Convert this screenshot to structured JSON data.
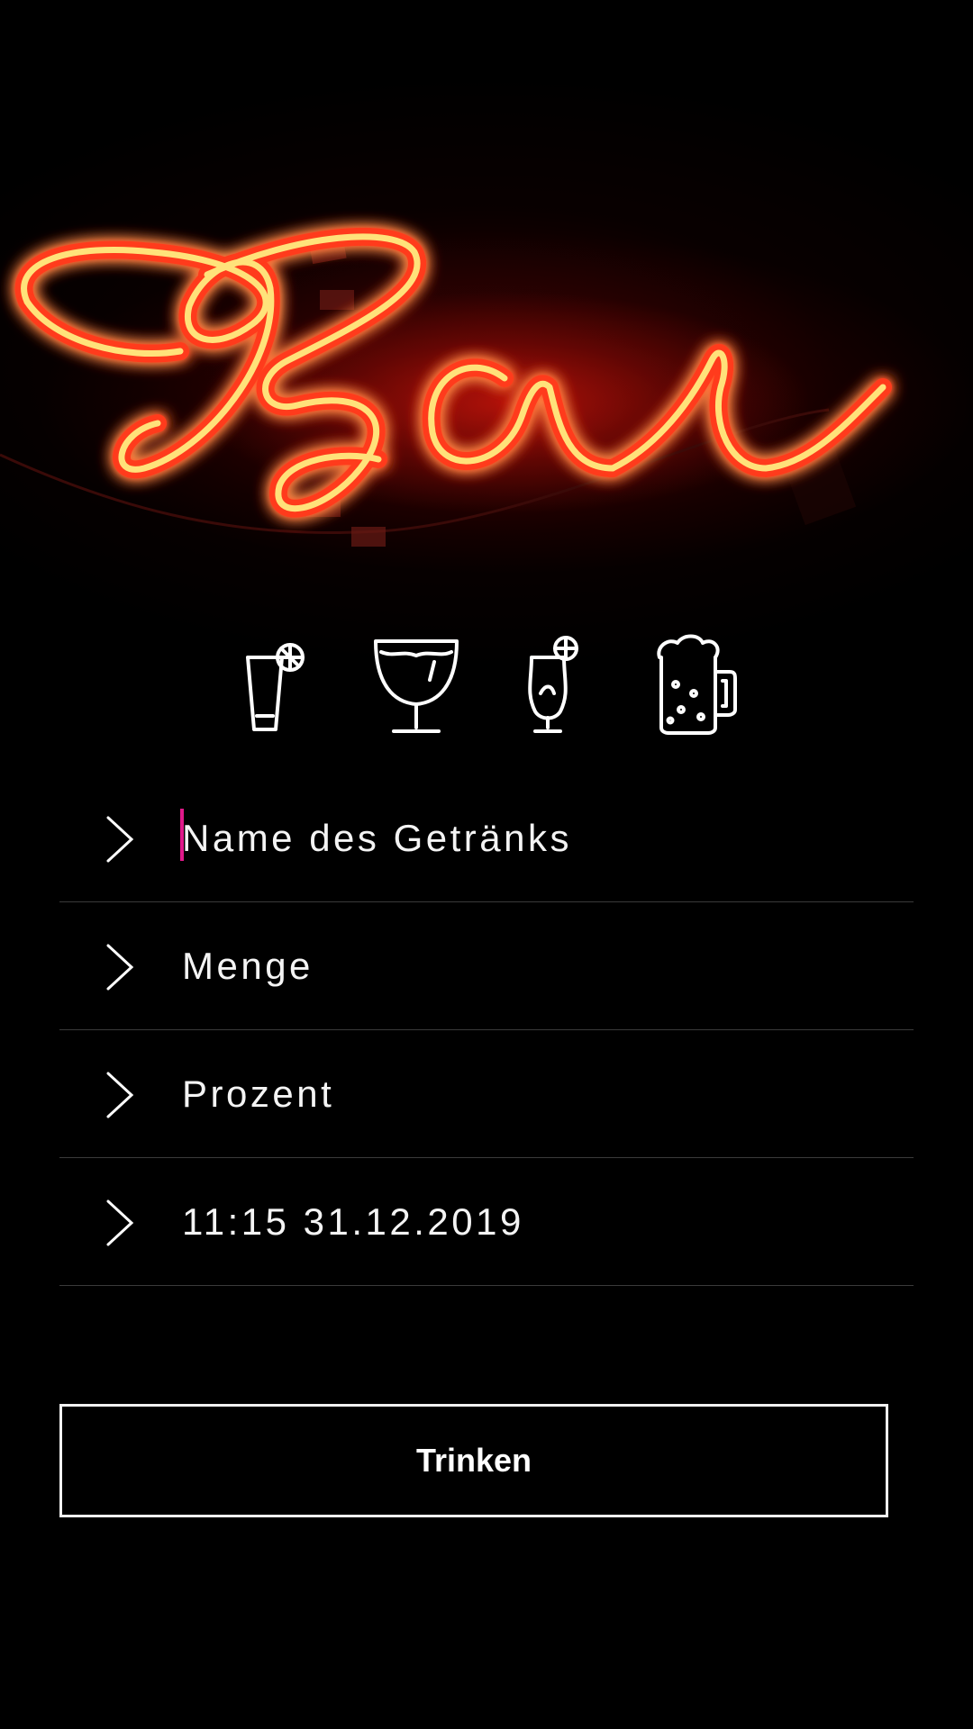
{
  "hero": {
    "sign_text": "Bar",
    "neon_color": "#ff3a1a",
    "neon_core_color": "#ffe27a"
  },
  "drink_types": [
    {
      "icon": "longdrink-glass-icon"
    },
    {
      "icon": "champagne-coupe-icon"
    },
    {
      "icon": "cocktail-glass-icon"
    },
    {
      "icon": "beer-mug-icon"
    }
  ],
  "form": {
    "name_placeholder": "Name des Getränks",
    "amount_placeholder": "Menge",
    "percent_placeholder": "Prozent",
    "datetime_value": "11:15 31.12.2019"
  },
  "actions": {
    "drink_label": "Trinken"
  },
  "colors": {
    "background": "#000000",
    "accent_caret": "#e0198a",
    "divider": "#3a3a3a",
    "text": "#ffffff"
  }
}
